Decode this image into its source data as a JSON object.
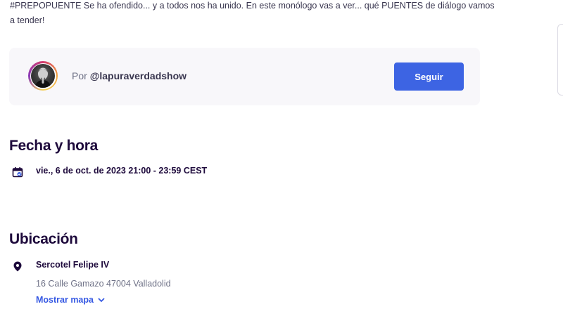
{
  "event": {
    "description": "#PREPOPUENTE Se ha ofendido... y a todos nos ha unido. En este monólogo vas a ver... qué PUENTES de diálogo vamos a tender!"
  },
  "organizer": {
    "prefix": "Por",
    "handle": "@lapuraverdadshow",
    "follow_label": "Seguir"
  },
  "date_section": {
    "title": "Fecha y hora",
    "datetime": "vie., 6 de oct. de 2023 21:00 - 23:59 CEST",
    "icon": "calendar-icon"
  },
  "location_section": {
    "title": "Ubicación",
    "venue": "Sercotel Felipe IV",
    "address": "16 Calle Gamazo 47004 Valladolid",
    "map_link": "Mostrar mapa",
    "icon": "map-pin-icon"
  },
  "colors": {
    "accent": "#3d64e3",
    "heading": "#1e0a3c",
    "card_bg": "#f8f7fa"
  }
}
